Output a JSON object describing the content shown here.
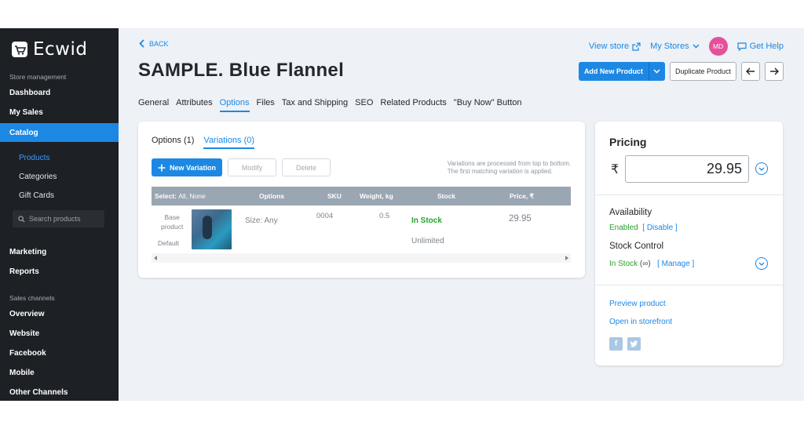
{
  "brand": {
    "name": "Ecwid"
  },
  "sidebar": {
    "store_management_label": "Store management",
    "dashboard": "Dashboard",
    "my_sales": "My Sales",
    "catalog": "Catalog",
    "catalog_items": [
      "Products",
      "Categories",
      "Gift Cards"
    ],
    "search_placeholder": "Search products",
    "marketing": "Marketing",
    "reports": "Reports",
    "sales_channels_label": "Sales channels",
    "channels": [
      "Overview",
      "Website",
      "Facebook",
      "Mobile",
      "Other Channels"
    ]
  },
  "header": {
    "back": "BACK",
    "title": "SAMPLE. Blue Flannel",
    "view_store": "View store",
    "my_stores": "My Stores",
    "avatar_initials": "MD",
    "get_help": "Get Help",
    "add_new_product": "Add New Product",
    "duplicate_product": "Duplicate Product"
  },
  "tabs": [
    "General",
    "Attributes",
    "Options",
    "Files",
    "Tax and Shipping",
    "SEO",
    "Related Products",
    "\"Buy Now\" Button"
  ],
  "variations": {
    "subtabs": [
      "Options (1)",
      "Variations (0)"
    ],
    "new_variation": "New Variation",
    "modify": "Modify",
    "delete": "Delete",
    "note_line1": "Variations are processed from top to bottom.",
    "note_line2": "The first matching variation is applied.",
    "columns": {
      "select_prefix": "Select:",
      "select_links": "All, None",
      "options": "Options",
      "sku": "SKU",
      "weight": "Weight, kg",
      "stock": "Stock",
      "price": "Price, ₹"
    },
    "row": {
      "base_line1": "Base",
      "base_line2": "product",
      "default": "Default",
      "options": "Size: Any",
      "sku": "0004",
      "weight": "0.5",
      "stock": "In Stock",
      "stock_sub": "Unlimited",
      "price": "29.95"
    }
  },
  "pricing": {
    "title": "Pricing",
    "currency": "₹",
    "price": "29.95",
    "availability_label": "Availability",
    "availability_value": "Enabled",
    "disable": "[ Disable ]",
    "stock_control_label": "Stock Control",
    "stock_value": "In Stock",
    "stock_qty": "(∞)",
    "manage": "[ Manage ]",
    "preview_product": "Preview product",
    "open_storefront": "Open in storefront"
  },
  "colors": {
    "accent": "#1c88e4",
    "sidebar_bg": "#1d2025",
    "success": "#27a32c",
    "avatar": "#e5509a"
  },
  "icons": [
    "cart-icon",
    "search-icon",
    "chevron-left-icon",
    "external-link-icon",
    "chevron-down-icon",
    "chat-icon",
    "arrow-left-icon",
    "arrow-right-icon",
    "plus-icon",
    "facebook-icon",
    "twitter-icon"
  ]
}
